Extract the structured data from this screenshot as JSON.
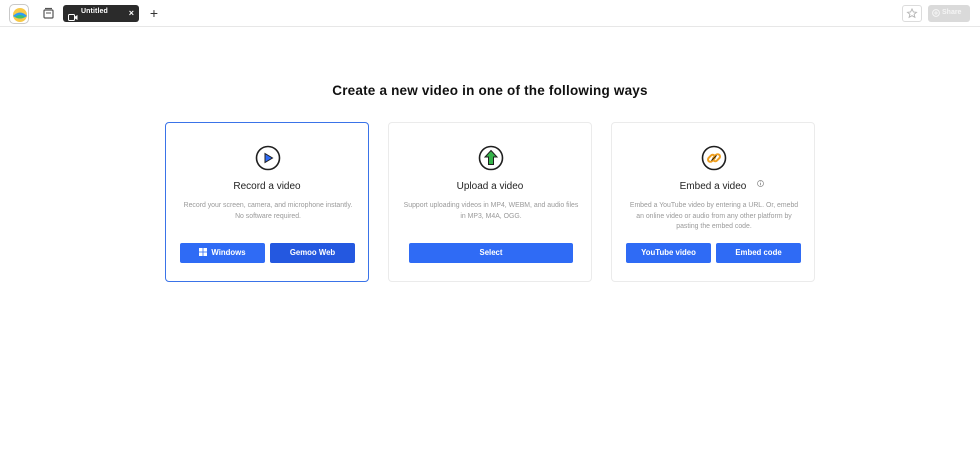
{
  "topbar": {
    "tab": {
      "title": "Untitled",
      "close": "×"
    },
    "new_tab": "+",
    "share_label": "Share"
  },
  "heading": "Create a new video in one of the following ways",
  "cards": [
    {
      "title": "Record a video",
      "description": "Record your screen, camera, and microphone instantly. No software required.",
      "buttons": [
        "Windows",
        "Gemoo Web"
      ]
    },
    {
      "title": "Upload a video",
      "description": "Support uploading videos in MP4, WEBM, and audio files in MP3, M4A, OGG.",
      "buttons": [
        "Select"
      ]
    },
    {
      "title": "Embed a video",
      "description": "Embed a YouTube video by entering a URL. Or, emebd an online video or audio from any other platform by pasting the embed code.",
      "buttons": [
        "YouTube video",
        "Embed code"
      ]
    }
  ],
  "colors": {
    "primary": "#2f6bf5",
    "primary_dark": "#2458e0",
    "selected_border": "#3a73e8",
    "tab_bg": "#2b2b2b"
  }
}
